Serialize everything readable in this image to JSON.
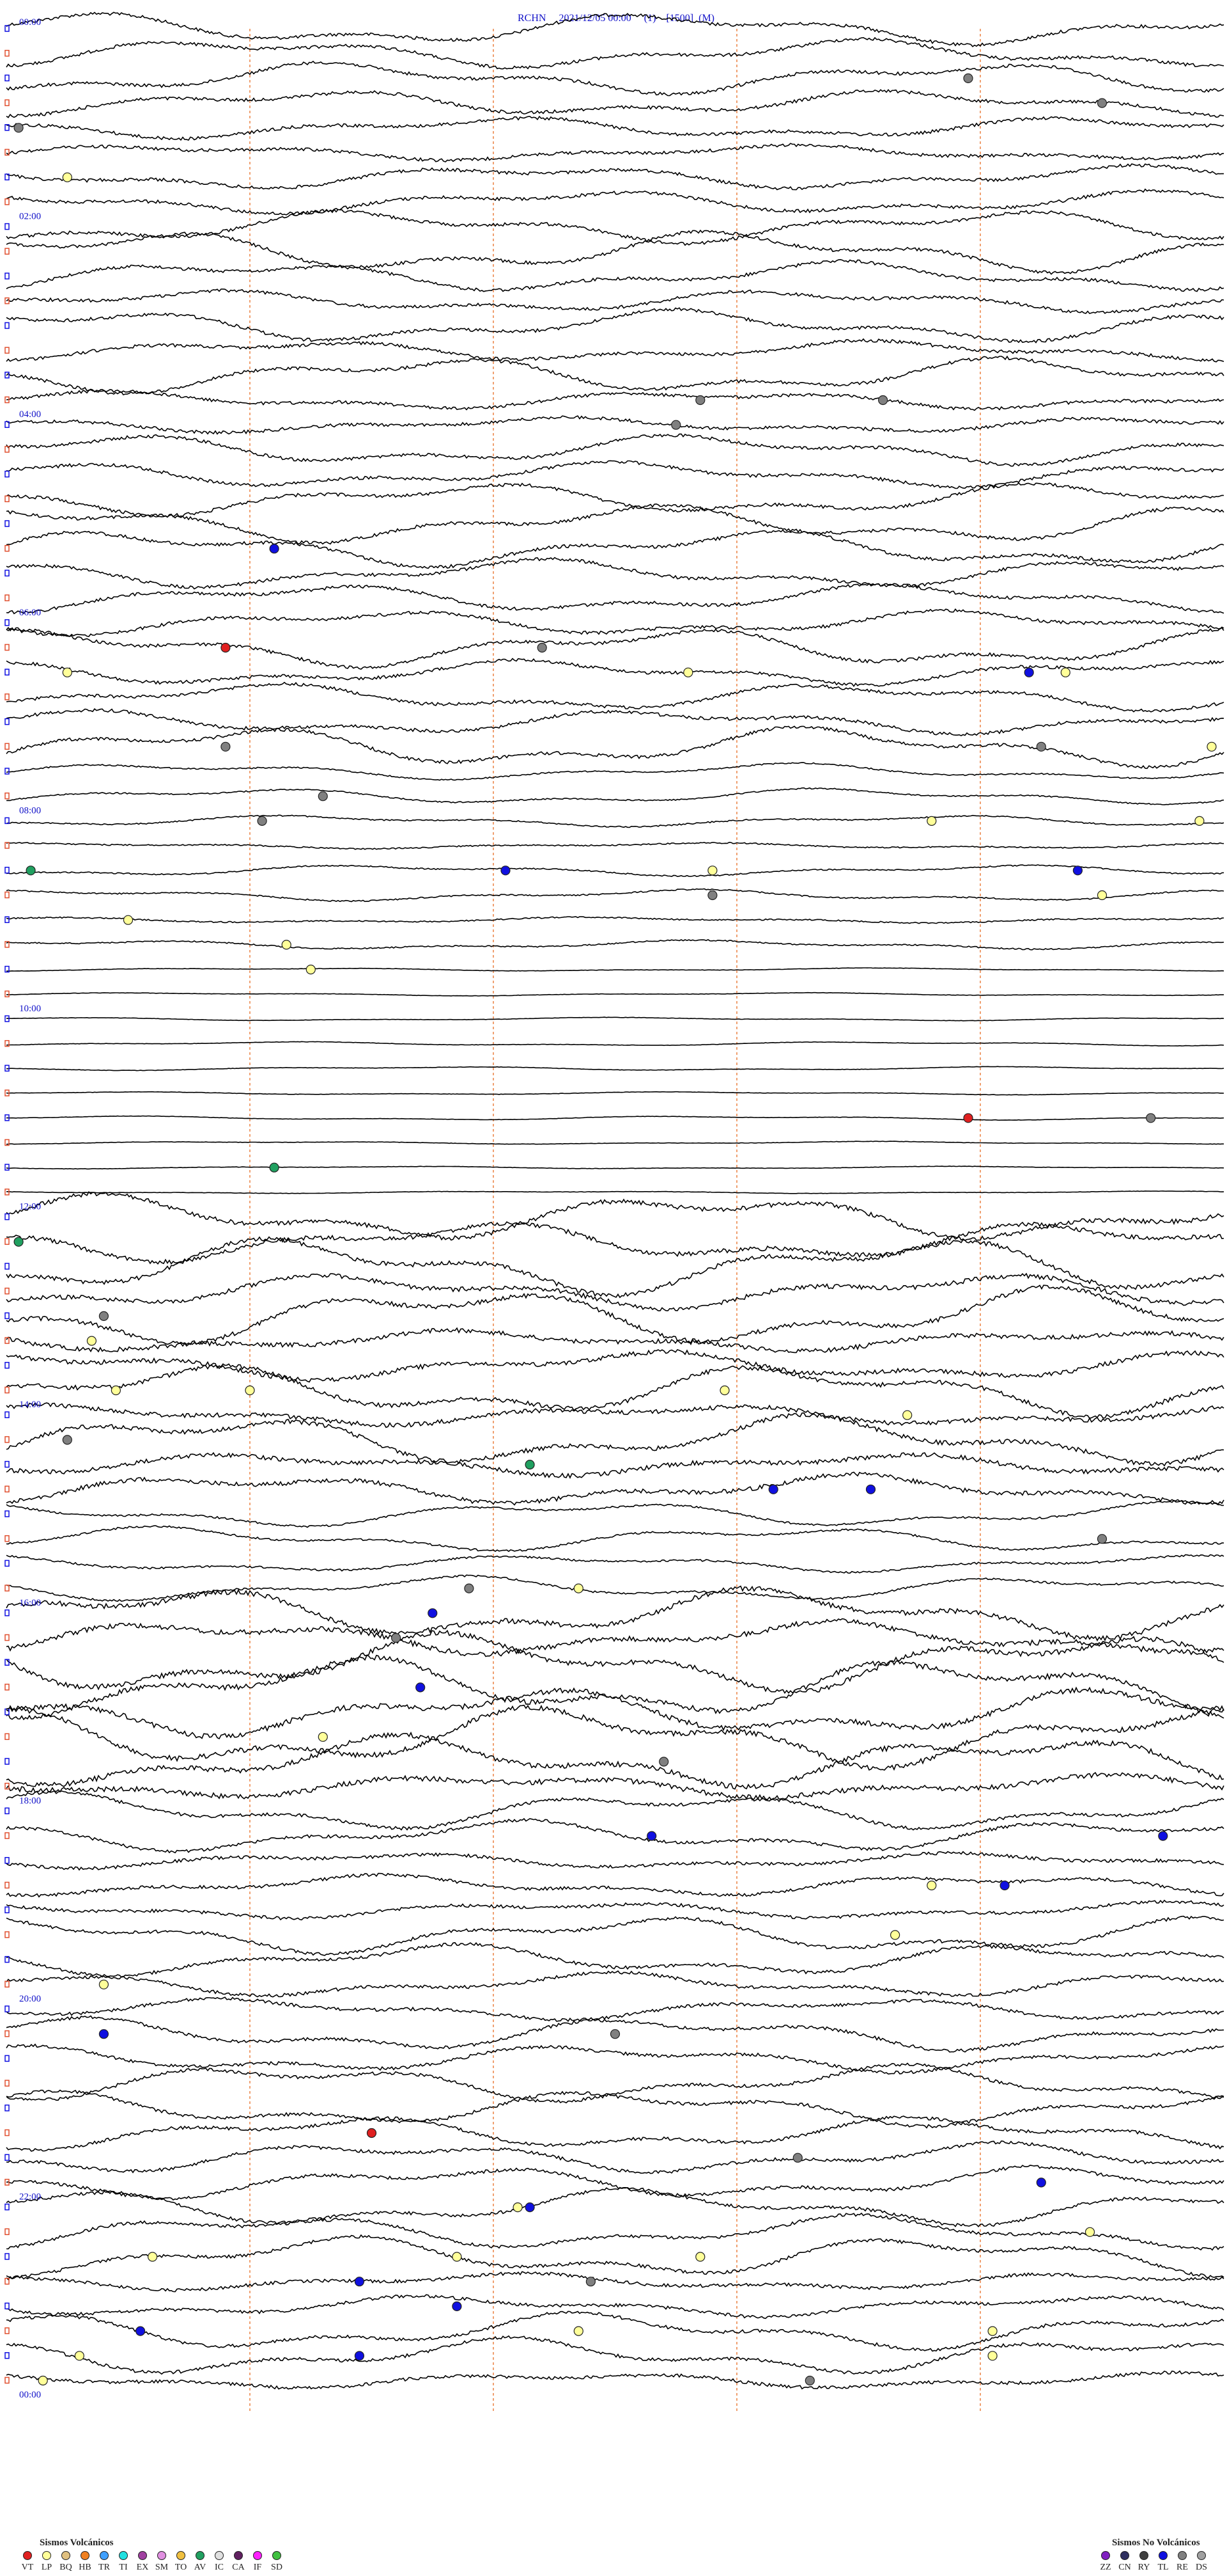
{
  "header": {
    "station": "RCHN",
    "date": "2021/12/05 00:00",
    "channel": "(1)",
    "scale": "[1500]",
    "mode": "(M)"
  },
  "chart_data": {
    "type": "scatter",
    "time_labels": [
      "00:00",
      "02:00",
      "04:00",
      "06:00",
      "08:00",
      "10:00",
      "12:00",
      "14:00",
      "16:00",
      "18:00",
      "20:00",
      "22:00",
      "00:00"
    ],
    "rows_per_label": 8,
    "total_rows": 96,
    "events": [
      {
        "row": 2,
        "x": 0.79,
        "class": "RE"
      },
      {
        "row": 3,
        "x": 0.9,
        "class": "RE"
      },
      {
        "row": 4,
        "x": 0.01,
        "class": "RE"
      },
      {
        "row": 6,
        "x": 0.05,
        "class": "LP"
      },
      {
        "row": 15,
        "x": 0.57,
        "class": "RE"
      },
      {
        "row": 15,
        "x": 0.72,
        "class": "RE"
      },
      {
        "row": 16,
        "x": 0.55,
        "class": "RE"
      },
      {
        "row": 21,
        "x": 0.22,
        "class": "TL"
      },
      {
        "row": 25,
        "x": 0.18,
        "class": "VT"
      },
      {
        "row": 25,
        "x": 0.44,
        "class": "RE"
      },
      {
        "row": 26,
        "x": 0.05,
        "class": "LP"
      },
      {
        "row": 26,
        "x": 0.56,
        "class": "LP"
      },
      {
        "row": 26,
        "x": 0.84,
        "class": "TL"
      },
      {
        "row": 26,
        "x": 0.87,
        "class": "LP"
      },
      {
        "row": 29,
        "x": 0.18,
        "class": "RE"
      },
      {
        "row": 29,
        "x": 0.85,
        "class": "RE"
      },
      {
        "row": 29,
        "x": 0.99,
        "class": "LP"
      },
      {
        "row": 31,
        "x": 0.26,
        "class": "RE"
      },
      {
        "row": 32,
        "x": 0.21,
        "class": "RE"
      },
      {
        "row": 32,
        "x": 0.76,
        "class": "LP"
      },
      {
        "row": 32,
        "x": 0.98,
        "class": "LP"
      },
      {
        "row": 34,
        "x": 0.02,
        "class": "AV"
      },
      {
        "row": 34,
        "x": 0.41,
        "class": "TL"
      },
      {
        "row": 34,
        "x": 0.58,
        "class": "LP"
      },
      {
        "row": 34,
        "x": 0.88,
        "class": "TL"
      },
      {
        "row": 35,
        "x": 0.58,
        "class": "RE"
      },
      {
        "row": 35,
        "x": 0.9,
        "class": "LP"
      },
      {
        "row": 36,
        "x": 0.1,
        "class": "LP"
      },
      {
        "row": 37,
        "x": 0.23,
        "class": "LP"
      },
      {
        "row": 38,
        "x": 0.25,
        "class": "LP"
      },
      {
        "row": 44,
        "x": 0.79,
        "class": "VT"
      },
      {
        "row": 44,
        "x": 0.94,
        "class": "RE"
      },
      {
        "row": 46,
        "x": 0.22,
        "class": "AV"
      },
      {
        "row": 49,
        "x": 0.01,
        "class": "AV"
      },
      {
        "row": 52,
        "x": 0.08,
        "class": "RE"
      },
      {
        "row": 53,
        "x": 0.07,
        "class": "LP"
      },
      {
        "row": 55,
        "x": 0.2,
        "class": "LP"
      },
      {
        "row": 55,
        "x": 0.09,
        "class": "LP"
      },
      {
        "row": 55,
        "x": 0.59,
        "class": "LP"
      },
      {
        "row": 56,
        "x": 0.74,
        "class": "LP"
      },
      {
        "row": 57,
        "x": 0.05,
        "class": "RE"
      },
      {
        "row": 58,
        "x": 0.43,
        "class": "AV"
      },
      {
        "row": 59,
        "x": 0.63,
        "class": "TL"
      },
      {
        "row": 59,
        "x": 0.71,
        "class": "TL"
      },
      {
        "row": 61,
        "x": 0.9,
        "class": "RE"
      },
      {
        "row": 63,
        "x": 0.38,
        "class": "RE"
      },
      {
        "row": 63,
        "x": 0.47,
        "class": "LP"
      },
      {
        "row": 64,
        "x": 0.35,
        "class": "TL"
      },
      {
        "row": 65,
        "x": 0.32,
        "class": "RE"
      },
      {
        "row": 67,
        "x": 0.34,
        "class": "TL"
      },
      {
        "row": 69,
        "x": 0.26,
        "class": "LP"
      },
      {
        "row": 70,
        "x": 0.54,
        "class": "RE"
      },
      {
        "row": 73,
        "x": 0.53,
        "class": "TL"
      },
      {
        "row": 73,
        "x": 0.95,
        "class": "TL"
      },
      {
        "row": 75,
        "x": 0.76,
        "class": "LP"
      },
      {
        "row": 75,
        "x": 0.82,
        "class": "TL"
      },
      {
        "row": 77,
        "x": 0.73,
        "class": "LP"
      },
      {
        "row": 79,
        "x": 0.08,
        "class": "LP"
      },
      {
        "row": 81,
        "x": 0.08,
        "class": "TL"
      },
      {
        "row": 81,
        "x": 0.5,
        "class": "RE"
      },
      {
        "row": 85,
        "x": 0.3,
        "class": "VT"
      },
      {
        "row": 86,
        "x": 0.65,
        "class": "RE"
      },
      {
        "row": 87,
        "x": 0.85,
        "class": "TL"
      },
      {
        "row": 88,
        "x": 0.42,
        "class": "LP"
      },
      {
        "row": 88,
        "x": 0.43,
        "class": "TL"
      },
      {
        "row": 89,
        "x": 0.89,
        "class": "LP"
      },
      {
        "row": 90,
        "x": 0.37,
        "class": "LP"
      },
      {
        "row": 90,
        "x": 0.57,
        "class": "LP"
      },
      {
        "row": 90,
        "x": 0.12,
        "class": "LP"
      },
      {
        "row": 91,
        "x": 0.29,
        "class": "TL"
      },
      {
        "row": 91,
        "x": 0.48,
        "class": "RE"
      },
      {
        "row": 92,
        "x": 0.37,
        "class": "TL"
      },
      {
        "row": 93,
        "x": 0.11,
        "class": "TL"
      },
      {
        "row": 93,
        "x": 0.81,
        "class": "LP"
      },
      {
        "row": 93,
        "x": 0.47,
        "class": "LP"
      },
      {
        "row": 94,
        "x": 0.06,
        "class": "LP"
      },
      {
        "row": 94,
        "x": 0.29,
        "class": "TL"
      },
      {
        "row": 95,
        "x": 0.03,
        "class": "LP"
      },
      {
        "row": 95,
        "x": 0.66,
        "class": "RE"
      },
      {
        "row": 94,
        "x": 0.81,
        "class": "LP"
      }
    ]
  },
  "legend": {
    "volcanic_title": "Sismos Volcánicos",
    "volcanic": [
      {
        "code": "VT",
        "color": "#e02020"
      },
      {
        "code": "LP",
        "color": "#ffff99"
      },
      {
        "code": "BQ",
        "color": "#e0c080"
      },
      {
        "code": "HB",
        "color": "#f08020"
      },
      {
        "code": "TR",
        "color": "#40a0ff"
      },
      {
        "code": "TI",
        "color": "#20e0e0"
      },
      {
        "code": "EX",
        "color": "#a040a0"
      },
      {
        "code": "SM",
        "color": "#e090e0"
      },
      {
        "code": "TO",
        "color": "#f0c040"
      },
      {
        "code": "AV",
        "color": "#20a060"
      },
      {
        "code": "IC",
        "color": "#e0e0e0"
      },
      {
        "code": "CA",
        "color": "#602060"
      },
      {
        "code": "IF",
        "color": "#ff20ff"
      },
      {
        "code": "SD",
        "color": "#40c040"
      }
    ],
    "non_volcanic_title": "Sismos No Volcánicos",
    "non_volcanic": [
      {
        "code": "ZZ",
        "color": "#8020c0"
      },
      {
        "code": "CN",
        "color": "#303060"
      },
      {
        "code": "RY",
        "color": "#404040"
      },
      {
        "code": "TL",
        "color": "#1010e0"
      },
      {
        "code": "RE",
        "color": "#808080"
      },
      {
        "code": "DS",
        "color": "#a0a0a0"
      }
    ]
  },
  "colors": {
    "trace": "#000000",
    "minute_marks": "#f0a070",
    "time_labels": "#1010c8",
    "row_ticks_blue": "#1010e0",
    "row_ticks_red": "#e05030"
  }
}
